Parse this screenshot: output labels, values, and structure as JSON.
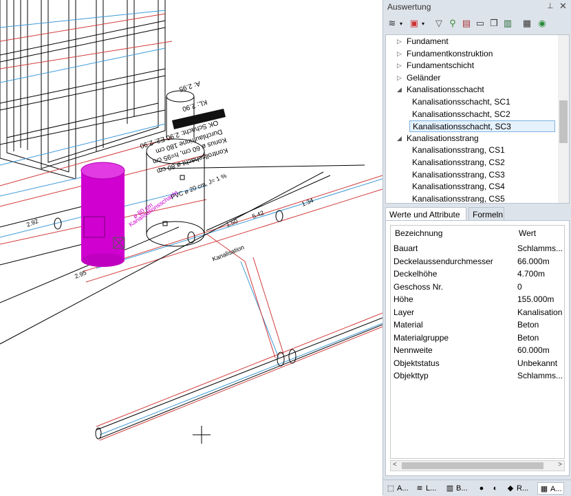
{
  "panel": {
    "title": "Auswertung",
    "pin_icon": "pin-icon",
    "close_icon": "close-icon",
    "toolbar": [
      "layers-icon",
      "dropdown-icon",
      "help-report-icon",
      "dropdown-icon",
      "filter-icon",
      "search-icon",
      "report-icon",
      "print-icon",
      "copy-icon",
      "export-icon",
      "database-icon",
      "globe-icon"
    ],
    "tree": [
      {
        "label": "Fundament",
        "level": 0,
        "arrow": "▷"
      },
      {
        "label": "Fundamentkonstruktion",
        "level": 0,
        "arrow": "▷"
      },
      {
        "label": "Fundamentschicht",
        "level": 0,
        "arrow": "▷"
      },
      {
        "label": "Geländer",
        "level": 0,
        "arrow": "▷"
      },
      {
        "label": "Kanalisationsschacht",
        "level": 0,
        "arrow": "◢"
      },
      {
        "label": "Kanalisationsschacht, SC1",
        "level": 1
      },
      {
        "label": "Kanalisationsschacht, SC2",
        "level": 1
      },
      {
        "label": "Kanalisationsschacht, SC3",
        "level": 1,
        "selected": true
      },
      {
        "label": "Kanalisationsstrang",
        "level": 0,
        "arrow": "◢"
      },
      {
        "label": "Kanalisationsstrang, CS1",
        "level": 1
      },
      {
        "label": "Kanalisationsstrang, CS2",
        "level": 1
      },
      {
        "label": "Kanalisationsstrang, CS3",
        "level": 1
      },
      {
        "label": "Kanalisationsstrang, CS4",
        "level": 1
      },
      {
        "label": "Kanalisationsstrang, CS5",
        "level": 1
      }
    ],
    "tabs": [
      "Werte und Attribute",
      "Formeln"
    ],
    "props_header": {
      "name": "Bezeichnung",
      "value": "Wert"
    },
    "props": [
      {
        "k": "Bauart",
        "v": "Schlamms..."
      },
      {
        "k": "Deckelaussendurchmesser",
        "v": "66.000m"
      },
      {
        "k": "Deckelhöhe",
        "v": "4.700m"
      },
      {
        "k": "Geschoss Nr.",
        "v": "0"
      },
      {
        "k": "Höhe",
        "v": "155.000m"
      },
      {
        "k": "Layer",
        "v": "Kanalisation"
      },
      {
        "k": "Material",
        "v": "Beton"
      },
      {
        "k": "Materialgruppe",
        "v": "Beton"
      },
      {
        "k": "Nennweite",
        "v": "60.000m"
      },
      {
        "k": "Objektstatus",
        "v": "Unbekannt"
      },
      {
        "k": "Objekttyp",
        "v": "Schlamms..."
      }
    ],
    "bottom_tabs": [
      {
        "icon": "cube-icon",
        "label": "A..."
      },
      {
        "icon": "layers-icon",
        "label": "L..."
      },
      {
        "icon": "books-icon",
        "label": "B..."
      },
      {
        "icon": "sphere-icon",
        "label": ""
      },
      {
        "icon": "palette-icon",
        "label": ""
      },
      {
        "icon": "tag-icon",
        "label": "R..."
      },
      {
        "icon": "calculator-icon",
        "label": "A..."
      }
    ]
  },
  "drawing": {
    "labels": [
      "Kontrollschacht ø 80 cm",
      "Konus ø 60 cm, h=95 cm",
      "Durchlaufrinne 180 cm",
      "OK Schacht: 2.90  E2: 2.90",
      "KL: 2.90",
      "A: 2.95",
      "PVC ø 20 cm, J= 1 %",
      "2.95",
      "1.34",
      "1.50",
      "5.42",
      "2.92",
      "Kanalisation"
    ]
  }
}
